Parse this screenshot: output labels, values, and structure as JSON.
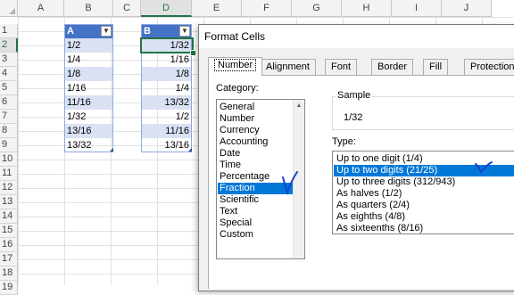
{
  "spreadsheet": {
    "columns": [
      "A",
      "B",
      "C",
      "D",
      "E",
      "F",
      "G",
      "H",
      "I",
      "J"
    ],
    "selected_column": "D",
    "rows": [
      "1",
      "2",
      "3",
      "4",
      "5",
      "6",
      "7",
      "8",
      "9",
      "10",
      "11",
      "12",
      "13",
      "14",
      "15",
      "16",
      "17",
      "18",
      "19"
    ],
    "selected_row": "2",
    "table_b": {
      "header": "A",
      "values": [
        "1/2",
        "1/4",
        "1/8",
        "1/16",
        "11/16",
        "1/32",
        "13/16",
        "13/32"
      ]
    },
    "table_d": {
      "header": "B",
      "values": [
        "1/32",
        "1/16",
        "1/8",
        "1/4",
        "13/32",
        "1/2",
        "11/16",
        "13/16"
      ]
    },
    "filter_icon": "sort-filter-icon"
  },
  "dialog": {
    "title": "Format Cells",
    "tabs": [
      "Number",
      "Alignment",
      "Font",
      "Border",
      "Fill",
      "Protection"
    ],
    "active_tab": "Number",
    "category_label": "Category:",
    "categories": [
      "General",
      "Number",
      "Currency",
      "Accounting",
      "Date",
      "Time",
      "Percentage",
      "Fraction",
      "Scientific",
      "Text",
      "Special",
      "Custom"
    ],
    "selected_category": "Fraction",
    "sample_label": "Sample",
    "sample_value": "1/32",
    "type_label": "Type:",
    "types": [
      "Up to one digit (1/4)",
      "Up to two digits (21/25)",
      "Up to three digits (312/943)",
      "As halves (1/2)",
      "As quarters (2/4)",
      "As eighths (4/8)",
      "As sixteenths (8/16)"
    ],
    "selected_type": "Up to two digits (21/25)",
    "annotation_color": "#1a3fd0",
    "selection_color": "#0078d7",
    "table_header_color": "#4472c4",
    "table_band_color": "#d9e1f2"
  }
}
